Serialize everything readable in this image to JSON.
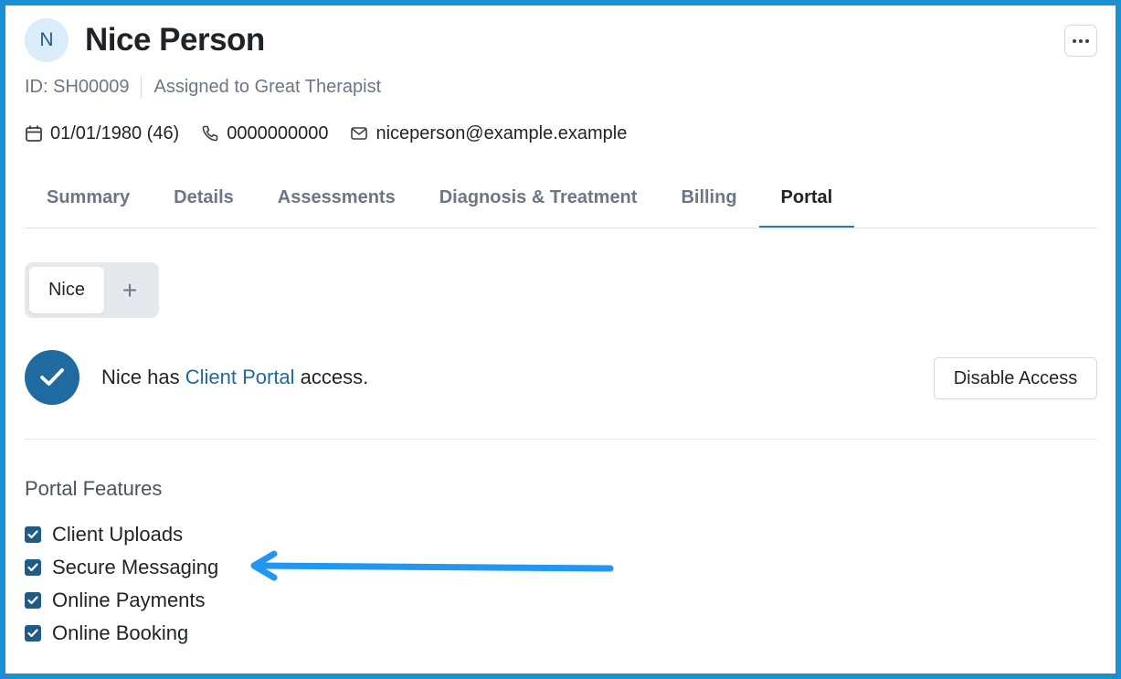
{
  "client": {
    "initial": "N",
    "name": "Nice Person",
    "id_text": "ID: SH00009",
    "assigned_text": "Assigned to Great Therapist",
    "dob": "01/01/1980 (46)",
    "phone": "0000000000",
    "email": "niceperson@example.example"
  },
  "header": {
    "more_icon": "ellipsis-icon"
  },
  "tabs": [
    {
      "label": "Summary"
    },
    {
      "label": "Details"
    },
    {
      "label": "Assessments"
    },
    {
      "label": "Diagnosis & Treatment"
    },
    {
      "label": "Billing"
    },
    {
      "label": "Portal",
      "active": true
    }
  ],
  "portal": {
    "subtabs": {
      "contact_label": "Nice",
      "add_label": "+"
    },
    "access": {
      "prefix": "Nice has ",
      "link": "Client Portal",
      "suffix": " access.",
      "disable_button": "Disable Access"
    },
    "features_title": "Portal Features",
    "features": [
      {
        "label": "Client Uploads",
        "checked": true
      },
      {
        "label": "Secure Messaging",
        "checked": true
      },
      {
        "label": "Online Payments",
        "checked": true
      },
      {
        "label": "Online Booking",
        "checked": true
      }
    ]
  },
  "colors": {
    "frame": "#1a8fd4",
    "accent": "#1f6aa1",
    "annotation_arrow": "#2196f3"
  }
}
